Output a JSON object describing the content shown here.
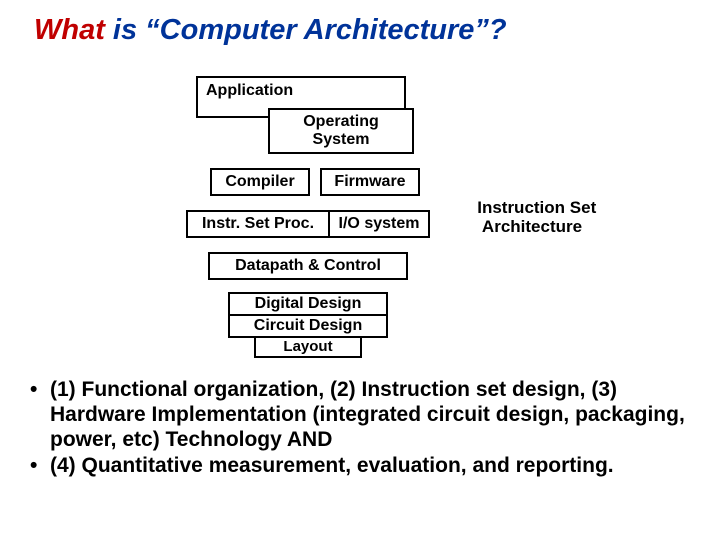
{
  "title": {
    "what": "What",
    "rest": " is “Computer Architecture”?"
  },
  "boxes": {
    "application": "Application",
    "os": "Operating\nSystem",
    "compiler": "Compiler",
    "firmware": "Firmware",
    "isp": "Instr. Set Proc.",
    "io": "I/O system",
    "datapath": "Datapath & Control",
    "digital": "Digital Design",
    "circuit": "Circuit Design",
    "layout": "Layout"
  },
  "annotation": "Instruction Set\nArchitecture",
  "bullets": [
    "(1) Functional organization, (2) Instruction set design,  (3) Hardware Implementation (integrated circuit design, packaging, power, etc) Technology AND",
    "(4) Quantitative measurement,   evaluation,  and reporting."
  ]
}
